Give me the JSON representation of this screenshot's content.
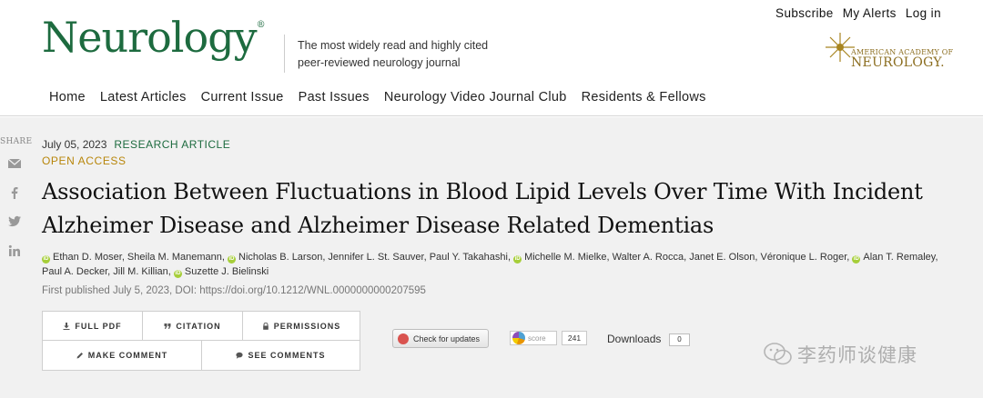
{
  "top_links": [
    "Subscribe",
    "My Alerts",
    "Log in"
  ],
  "logo": {
    "text": "Neurology",
    "mark": "®"
  },
  "tagline": {
    "line1": "The most widely read and highly cited",
    "line2": "peer-reviewed neurology journal"
  },
  "aan": {
    "line1": "AMERICAN ACADEMY OF",
    "line2": "NEUROLOGY."
  },
  "nav": [
    "Home",
    "Latest Articles",
    "Current Issue",
    "Past Issues",
    "Neurology Video Journal Club",
    "Residents & Fellows"
  ],
  "share": {
    "label": "SHARE",
    "icons": [
      "email-icon",
      "facebook-icon",
      "twitter-icon",
      "linkedin-icon"
    ]
  },
  "article": {
    "date": "July 05, 2023",
    "type": "RESEARCH ARTICLE",
    "access": "OPEN ACCESS",
    "title_line1": "Association Between Fluctuations in Blood Lipid Levels Over Time With Incident",
    "title_line2": "Alzheimer Disease and Alzheimer Disease Related Dementias",
    "authors": [
      {
        "name": "Ethan D. Moser, Sheila M. Manemann,",
        "orcid": true
      },
      {
        "name": "Nicholas B. Larson, Jennifer L. St. Sauver, Paul Y. Takahashi,",
        "orcid": true
      },
      {
        "name": "Michelle M. Mielke, Walter A. Rocca, Janet E. Olson, Véronique L. Roger,",
        "orcid": true
      },
      {
        "name": "Alan T. Remaley,",
        "orcid": true
      },
      {
        "name": "Paul A. Decker, Jill M. Killian,",
        "orcid": false
      },
      {
        "name": "Suzette J. Bielinski",
        "orcid": true
      }
    ],
    "published": "First published July 5, 2023, DOI: https://doi.org/10.1212/WNL.0000000000207595"
  },
  "buttons": {
    "full_pdf": "FULL PDF",
    "citation": "CITATION",
    "permissions": "PERMISSIONS",
    "make_comment": "MAKE COMMENT",
    "see_comments": "SEE COMMENTS"
  },
  "metrics": {
    "check_updates": "Check for updates",
    "altmetric_label": "score",
    "altmetric_score": "241",
    "downloads_label": "Downloads",
    "downloads_count": "0"
  },
  "watermark": "李药师谈健康",
  "colors": {
    "brand_green": "#1d6b3f",
    "open_access_gold": "#b8860b",
    "orcid_green": "#a6ce39"
  }
}
